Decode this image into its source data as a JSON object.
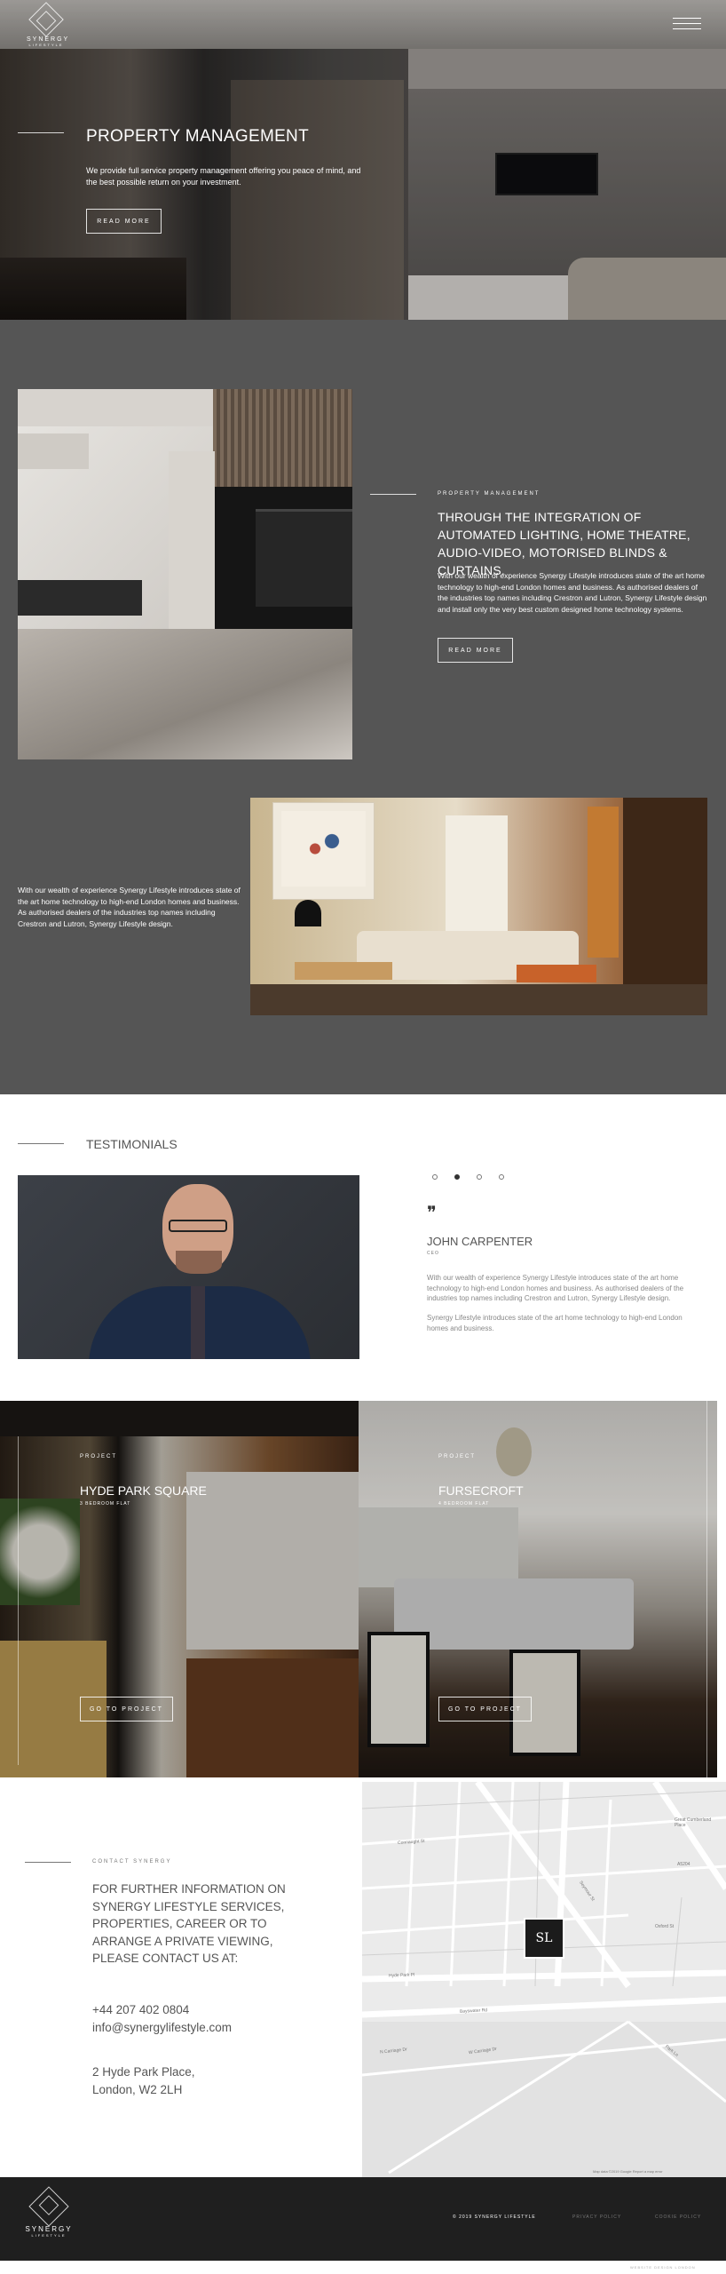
{
  "hero": {
    "logo_name": "SYNERGY",
    "logo_sub": "LIFESTYLE",
    "title": "PROPERTY MANAGEMENT",
    "text": "We provide full service property management offering you peace of mind, and the best possible return on your investment.",
    "button": "READ MORE"
  },
  "feature": {
    "kicker": "PROPERTY MANAGEMENT",
    "heading": "THROUGH THE INTEGRATION OF AUTOMATED LIGHTING, HOME THEATRE, AUDIO-VIDEO, MOTORISED BLINDS & CURTAINS.",
    "text": "With our wealth of experience Synergy Lifestyle introduces state of the art home technology to high-end London homes and business. As authorised dealers of the industries top names including Crestron and Lutron, Synergy Lifestyle design and install only the very best custom designed home technology systems.",
    "button": "READ MORE",
    "text2": "With our wealth of experience Synergy Lifestyle introduces state of the art home technology to high-end London homes and business. As authorised dealers of the industries top names including Crestron and Lutron, Synergy Lifestyle design."
  },
  "testimonials": {
    "title": "TESTIMONIALS",
    "quote_mark": "❞",
    "name": "JOHN CARPENTER",
    "role": "CEO",
    "para1": "With our wealth of experience Synergy Lifestyle introduces state of the art home technology to high-end London homes and business. As authorised dealers of the industries top names including Crestron and Lutron, Synergy Lifestyle design.",
    "para2": "Synergy Lifestyle introduces state of the art home technology to high-end London homes and business.",
    "active_dot": 1
  },
  "projects": [
    {
      "kicker": "PROJECT",
      "name": "HYDE PARK SQUARE",
      "sub": "3 BEDROOM FLAT",
      "button": "GO TO PROJECT"
    },
    {
      "kicker": "PROJECT",
      "name": "FURSECROFT",
      "sub": "4 BEDROOM FLAT",
      "button": "GO TO PROJECT"
    }
  ],
  "contact": {
    "kicker": "CONTACT SYNERGY",
    "heading_lines": [
      "FOR FURTHER INFORMATION ON",
      "SYNERGY LIFESTYLE SERVICES,",
      "PROPERTIES, CAREER OR TO",
      "ARRANGE A PRIVATE VIEWING,",
      "PLEASE CONTACT US AT:"
    ],
    "phone": "+44 207 402 0804",
    "email": "info@synergylifestyle.com",
    "address1": "2 Hyde Park Place,",
    "address2": "London, W2 2LH"
  },
  "map": {
    "streets": [
      "Connaught St",
      "Hyde Park Pl",
      "Bayswater Rd",
      "Oxford St",
      "Seymour St",
      "Great Cumberland Place",
      "W Carriage Dr",
      "N Carriage Dr",
      "Park Ln",
      "A5204"
    ],
    "marker": "SL",
    "attribution": "Map data ©2019 Google   Report a map error"
  },
  "footer": {
    "logo_name": "SYNERGY",
    "logo_sub": "LIFESTYLE",
    "copyright": "© 2019 SYNERGY LIFESTYLE",
    "links": [
      "PRIVACY POLICY",
      "COOKIE POLICY"
    ],
    "credit": "WEBSITE DESIGN LONDON"
  },
  "colors": {
    "dark_grey": "#555555",
    "footer": "#1f1f1f",
    "text": "#555555"
  }
}
